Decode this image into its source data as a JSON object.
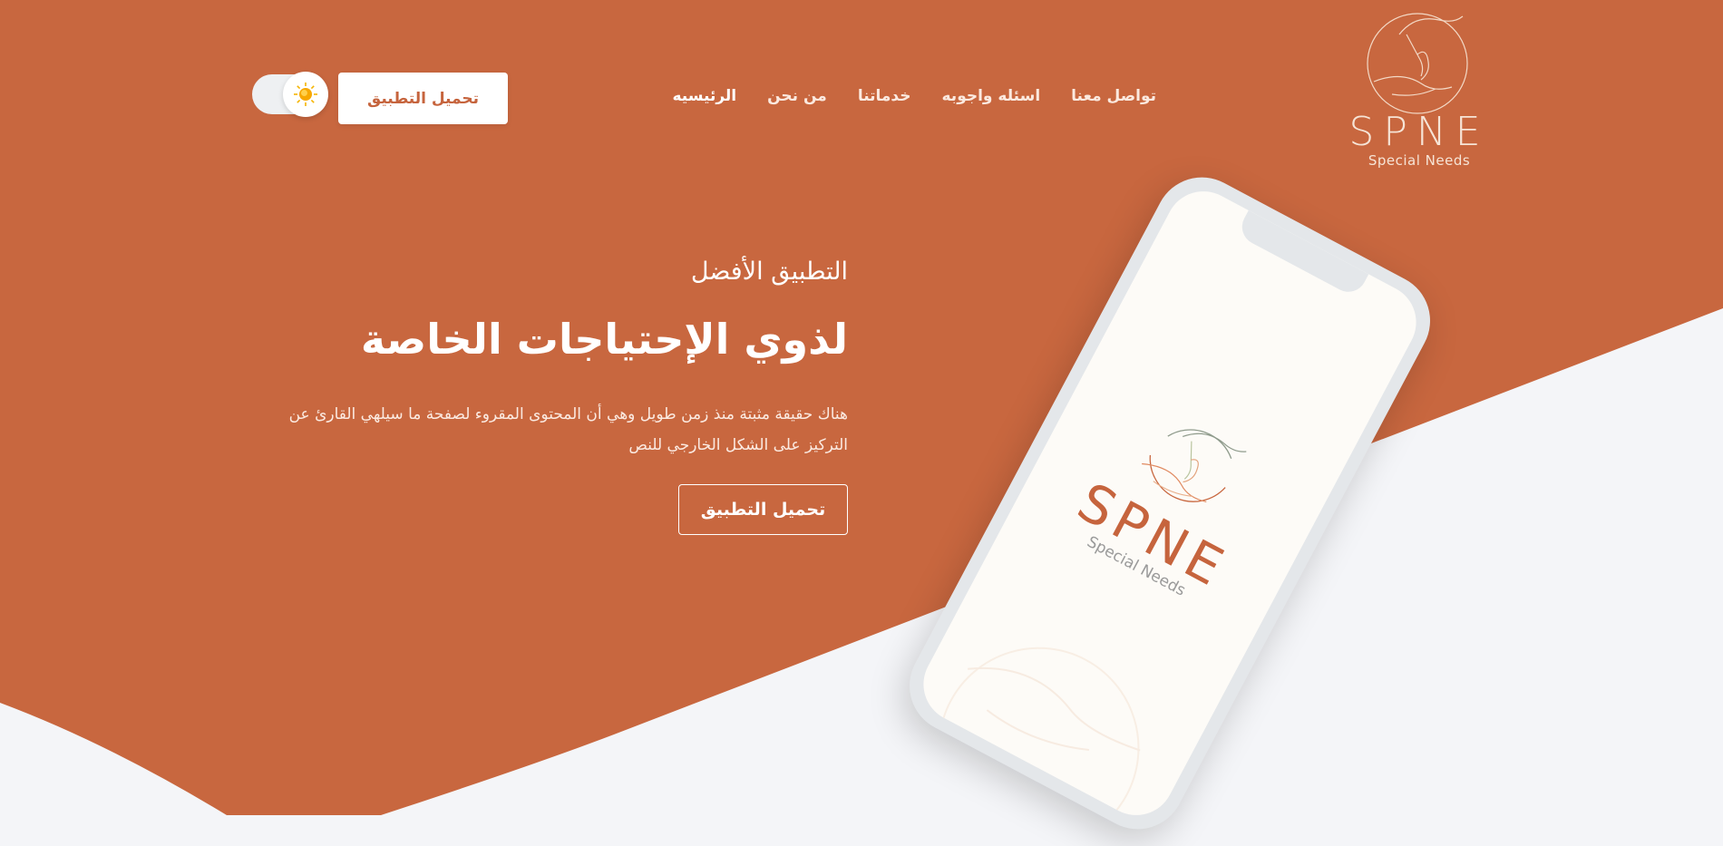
{
  "colors": {
    "primary": "#c8673f",
    "background": "#f4f5f8",
    "white": "#ffffff"
  },
  "brand": {
    "logo_text": "SPNE",
    "logo_subtitle": "Special Needs"
  },
  "nav": {
    "items": [
      {
        "label": "الرئيسيه",
        "active": true
      },
      {
        "label": "من نحن",
        "active": false
      },
      {
        "label": "خدماتنا",
        "active": false
      },
      {
        "label": "اسئله واجوبه",
        "active": false
      },
      {
        "label": "تواصل معنا",
        "active": false
      }
    ]
  },
  "header": {
    "download_label": "تحميل التطبيق",
    "theme_toggle_icon": "sun-icon"
  },
  "hero": {
    "kicker": "التطبيق الأفضل",
    "title": "لذوي الإحتياجات الخاصة",
    "description": "هناك حقيقة مثبتة منذ زمن طويل وهي أن المحتوى المقروء لصفحة ما سيلهي القارئ عن التركيز على الشكل الخارجي للنص",
    "download_label": "تحميل التطبيق"
  },
  "phone": {
    "logo_text": "SPNE",
    "logo_subtitle": "Special Needs"
  }
}
